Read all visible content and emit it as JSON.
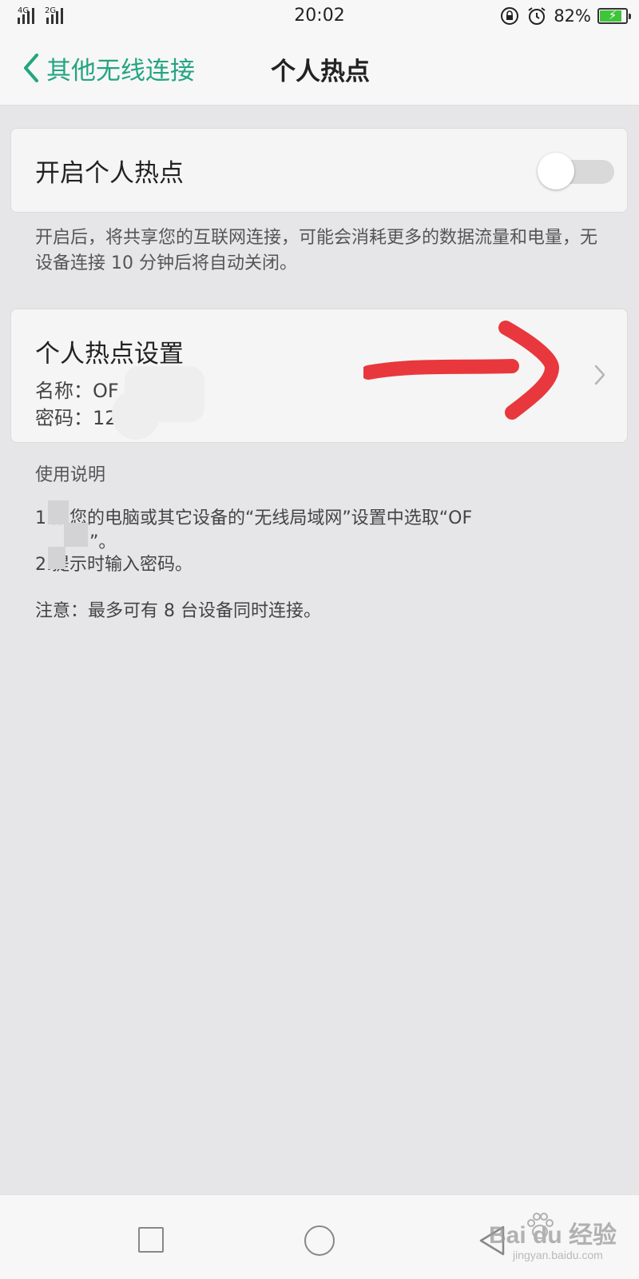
{
  "status_bar": {
    "net1": "4G",
    "net2": "2G",
    "time": "20:02",
    "battery_pct": "82%",
    "battery_level": 0.82,
    "icons": [
      "lock-rotation-icon",
      "alarm-icon",
      "battery-charging-icon"
    ]
  },
  "nav": {
    "back_label": "其他无线连接",
    "title": "个人热点"
  },
  "hotspot": {
    "label": "开启个人热点",
    "enabled": false,
    "description": "开启后，将共享您的互联网连接，可能会消耗更多的数据流量和电量，无设备连接 10 分钟后将自动关闭。"
  },
  "settings": {
    "title": "个人热点设置",
    "name_line": "名称：OF",
    "password_line": "密码：12"
  },
  "instructions": {
    "title": "使用说明",
    "step1": "1.从您的电脑或其它设备的“无线局域网”设置中选取“OF",
    "step1_cont": "”。",
    "step2": "2.提示时输入密码。",
    "note": "注意：最多可有 8 台设备同时连接。"
  },
  "watermark": {
    "brand": "Bai du 经验",
    "url": "jingyan.baidu.com"
  },
  "colors": {
    "accent": "#24a580",
    "annotation": "#e8383d",
    "background": "#e6e5e7",
    "card": "#f5f5f5"
  }
}
